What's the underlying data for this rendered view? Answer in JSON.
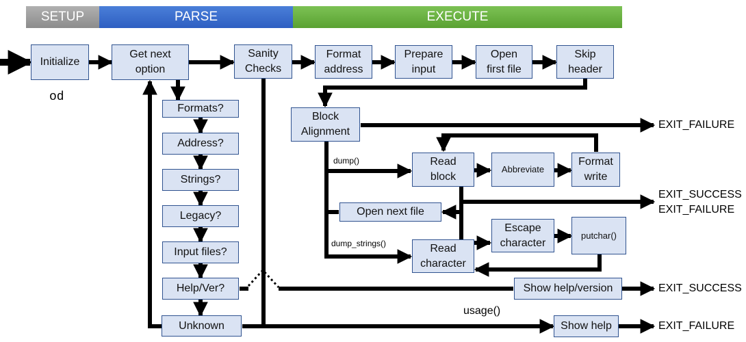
{
  "phases": {
    "setup": "SETUP",
    "parse": "PARSE",
    "execute": "EXECUTE"
  },
  "program_name": "od",
  "nodes": {
    "initialize": "Initialize",
    "get_next_option": "Get next\noption",
    "sanity_checks": "Sanity\nChecks",
    "format_address": "Format\naddress",
    "prepare_input": "Prepare\ninput",
    "open_first_file": "Open\nfirst file",
    "skip_header": "Skip\nheader",
    "formats": "Formats?",
    "address": "Address?",
    "strings": "Strings?",
    "legacy": "Legacy?",
    "input_files": "Input files?",
    "help_ver": "Help/Ver?",
    "unknown": "Unknown",
    "block_alignment": "Block\nAlignment",
    "read_block": "Read\nblock",
    "abbreviate": "Abbreviate",
    "format_write": "Format\nwrite",
    "open_next_file": "Open next file",
    "read_character": "Read\ncharacter",
    "escape_character": "Escape\ncharacter",
    "putchar": "putchar()",
    "show_help_version": "Show help/version",
    "show_help": "Show help"
  },
  "edge_labels": {
    "dump": "dump()",
    "dump_strings": "dump_strings()",
    "usage": "usage()"
  },
  "exits": {
    "block_alignment_exit": "EXIT_FAILURE",
    "read_block_exit": "EXIT_SUCCESS\nEXIT_FAILURE",
    "help_version_exit": "EXIT_SUCCESS",
    "show_help_exit": "EXIT_FAILURE"
  }
}
